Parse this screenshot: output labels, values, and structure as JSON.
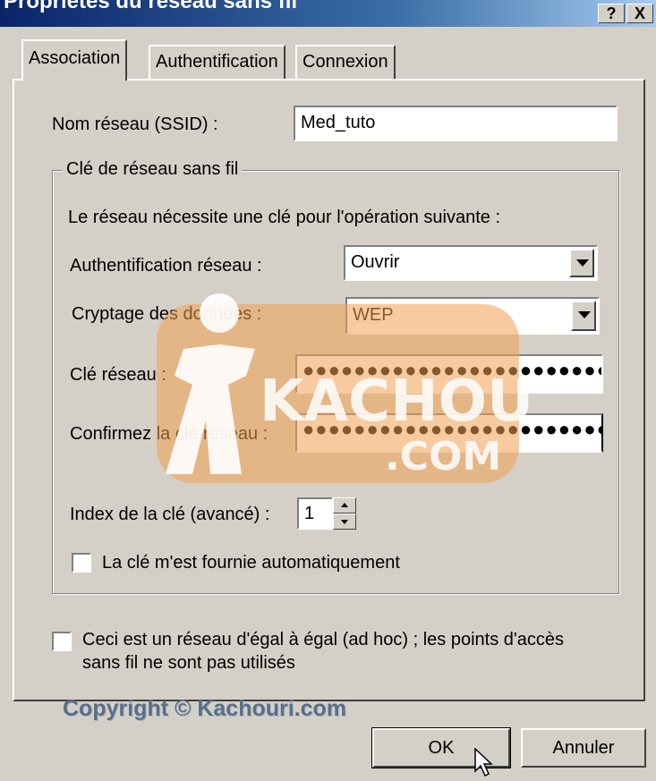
{
  "window": {
    "title": "Propriétés du réseau sans fil",
    "help_glyph": "?",
    "close_glyph": "X"
  },
  "tabs": [
    {
      "label": "Association",
      "active": true
    },
    {
      "label": "Authentification",
      "active": false
    },
    {
      "label": "Connexion",
      "active": false
    }
  ],
  "association": {
    "ssid_label": "Nom réseau (SSID) :",
    "ssid_value": "Med_tuto",
    "group_label": "Clé de réseau sans fil",
    "requirement_text": "Le réseau nécessite une clé pour l'opération suivante :",
    "auth_label": "Authentification réseau :",
    "auth_value": "Ouvrir",
    "encryption_label": "Cryptage des données :",
    "encryption_value": "WEP",
    "key_label": "Clé réseau :",
    "key_value": "●●●●●●●●●●●●●●●●●●●●●●●●●●",
    "confirm_label": "Confirmez la clé réseau :",
    "confirm_value": "●●●●●●●●●●●●●●●●●●●●●●●●●●",
    "index_label": "Index de la clé (avancé) :",
    "index_value": "1",
    "auto_key_label": "La clé m'est fournie automatiquement",
    "auto_key_checked": false,
    "adhoc_label_line1": "Ceci est un réseau d'égal à égal (ad hoc) ; les points d'accès",
    "adhoc_label_line2": "sans fil ne sont pas utilisés",
    "adhoc_checked": false
  },
  "buttons": {
    "ok": "OK",
    "cancel": "Annuler"
  },
  "watermark": {
    "brand": "KACHOURI",
    "domain": ".COM",
    "copyright": "Copyright © Kachouri.com"
  },
  "colors": {
    "dialog_bg": "#d4d0c8",
    "title_start": "#0a246a",
    "watermark_orange": "#f0a050"
  }
}
